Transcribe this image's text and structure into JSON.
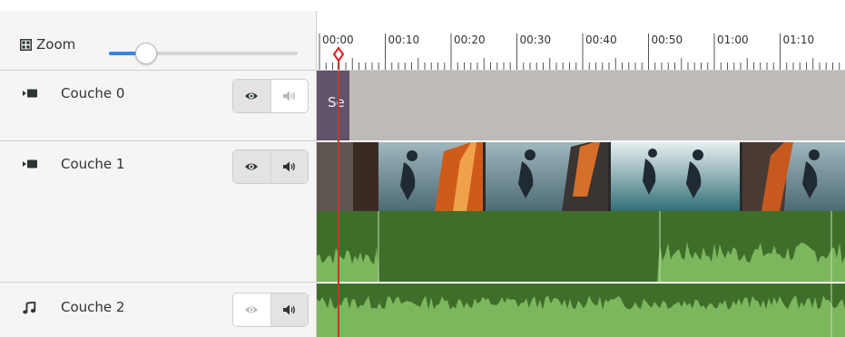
{
  "zoom": {
    "label": "Zoom",
    "level": 0.19
  },
  "ruler": {
    "labels": [
      "00:00",
      "00:10",
      "00:20",
      "00:30",
      "00:40",
      "00:50",
      "01:00",
      "01:10"
    ]
  },
  "playhead": {
    "time": "00:00"
  },
  "layers": [
    {
      "name": "Couche 0",
      "type": "video",
      "visibility_on": true,
      "audio_on": false
    },
    {
      "name": "Couche 1",
      "type": "video",
      "visibility_on": true,
      "audio_on": true
    },
    {
      "name": "Couche 2",
      "type": "audio",
      "visibility_on": false,
      "audio_on": true
    }
  ],
  "clips": {
    "title_clip_label": "Se"
  },
  "icons": {
    "zoom": "grid-icon",
    "video": "video-camera-icon",
    "audio": "music-note-icon",
    "eye": "eye-icon",
    "speaker": "speaker-icon"
  },
  "colors": {
    "accent": "#3584e4",
    "playhead": "#e01b24",
    "title_clip": "#61536a",
    "audio_dark": "#3f6e2a",
    "audio_light": "#7cb65d",
    "track_gray": "#bebab7"
  }
}
